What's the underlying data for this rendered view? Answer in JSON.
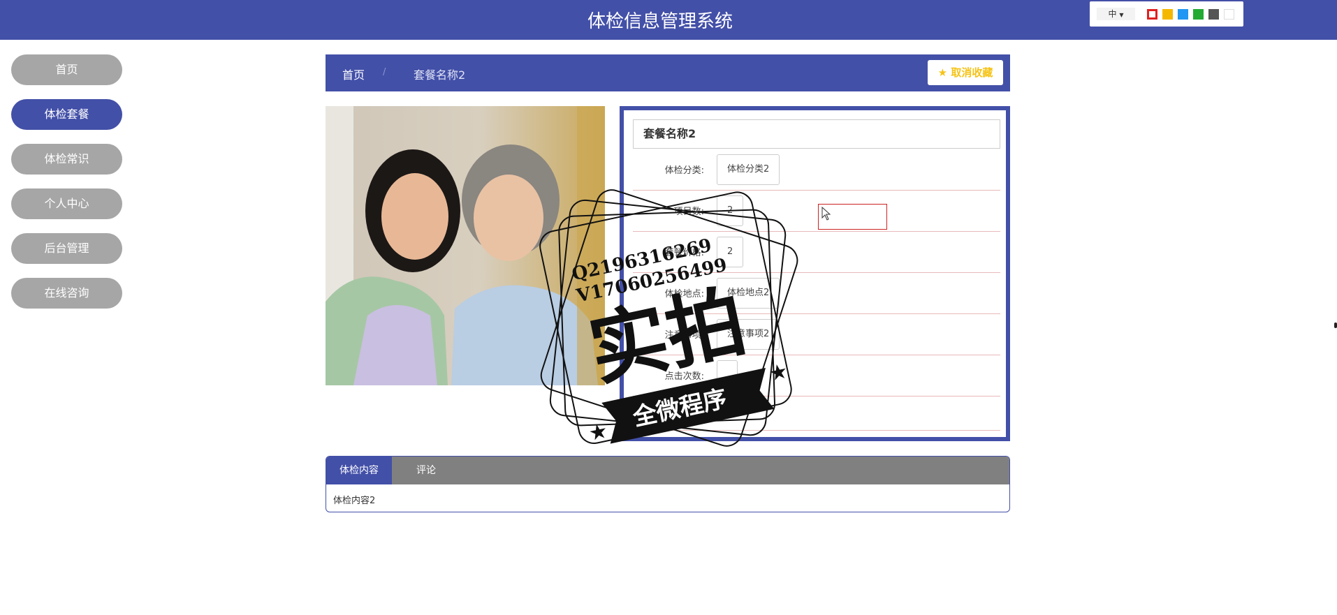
{
  "header": {
    "title": "体检信息管理系统"
  },
  "theme_switcher": {
    "language": "中",
    "swatches": [
      "#ffffff",
      "#f5b800",
      "#2196f3",
      "#22aa33",
      "#555555",
      "#ffffff"
    ],
    "selected_swatch_border": "#e02020"
  },
  "sidebar": {
    "items": [
      {
        "label": "首页"
      },
      {
        "label": "体检套餐",
        "active": true
      },
      {
        "label": "体检常识"
      },
      {
        "label": "个人中心"
      },
      {
        "label": "后台管理"
      },
      {
        "label": "在线咨询"
      }
    ]
  },
  "breadcrumb": {
    "home": "首页",
    "separator": "/",
    "current": "套餐名称2"
  },
  "favorite_button": {
    "label": "取消收藏",
    "icon": "star-icon"
  },
  "package": {
    "name": "套餐名称2",
    "fields": [
      {
        "label": "体检分类:",
        "value": "体检分类2"
      },
      {
        "label": "项目数:",
        "value": "2"
      },
      {
        "label": "套餐价格:",
        "value": "2"
      },
      {
        "label": "体检地点:",
        "value": "体检地点2"
      },
      {
        "label": "注意事项:",
        "value": "注意事项2"
      },
      {
        "label": "点击次数:",
        "value": ""
      }
    ]
  },
  "tabs": {
    "items": [
      {
        "label": "体检内容",
        "active": true
      },
      {
        "label": "评论"
      }
    ],
    "content": "体检内容2"
  },
  "watermark": {
    "line1": "Q2196316269",
    "line2": "V17060256499",
    "big": "实拍",
    "banner": "全微程序"
  }
}
